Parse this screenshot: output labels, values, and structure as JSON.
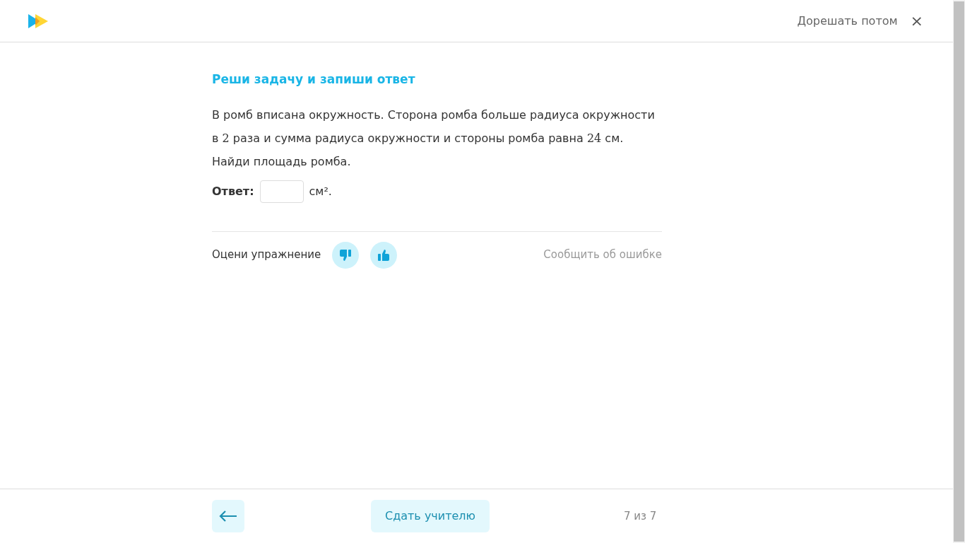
{
  "header": {
    "postpone_link": "Дорешать потом",
    "close_icon": "×"
  },
  "task": {
    "title": "Реши задачу и запиши ответ",
    "problem": [
      {
        "kind": "text",
        "text": "В ромб вписана окружность. Сторона ромба больше радиуса окружности в "
      },
      {
        "kind": "math",
        "text": "2"
      },
      {
        "kind": "text",
        "text": " раза и сумма радиуса окружности и стороны ромба равна "
      },
      {
        "kind": "math",
        "text": "24"
      },
      {
        "kind": "text",
        "text": " см. Найди площадь ромба."
      }
    ],
    "answer": {
      "label": "Ответ:",
      "unit": "см²."
    }
  },
  "rating": {
    "label": "Оцени упражнение",
    "report_link": "Сообщить об ошибке"
  },
  "footer": {
    "submit_button": "Сдать учителю",
    "progress": "7 из 7"
  }
}
